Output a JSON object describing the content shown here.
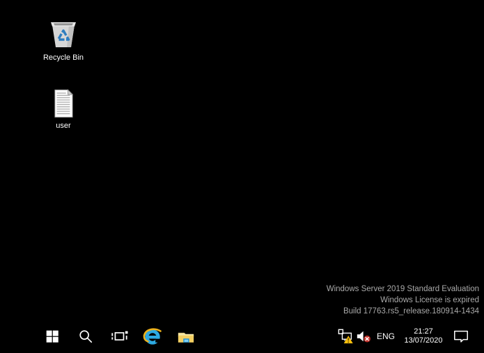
{
  "desktop": {
    "icons": [
      {
        "label": "Recycle Bin",
        "icon": "recycle-bin-icon"
      },
      {
        "label": "user",
        "icon": "text-file-icon"
      }
    ]
  },
  "watermark": {
    "line1": "Windows Server 2019 Standard Evaluation",
    "line2": "Windows License is expired",
    "line3": "Build 17763.rs5_release.180914-1434"
  },
  "taskbar": {
    "buttons": [
      {
        "name": "start",
        "icon": "windows-logo-icon"
      },
      {
        "name": "search",
        "icon": "search-icon"
      },
      {
        "name": "task-view",
        "icon": "task-view-icon"
      },
      {
        "name": "internet-explorer",
        "icon": "internet-explorer-icon"
      },
      {
        "name": "file-explorer",
        "icon": "file-explorer-icon"
      }
    ],
    "tray": {
      "network_icon": "ethernet-warning-icon",
      "volume_icon": "speaker-muted-icon",
      "language": "ENG",
      "time": "21:27",
      "date": "13/07/2020",
      "action_center_icon": "action-center-icon"
    }
  },
  "colors": {
    "background": "#000000",
    "watermark_gray": "#a9a9a9",
    "label_white": "#ffffff",
    "recycle_blue": "#2e7dbf",
    "ie_blue": "#2da9e1",
    "ie_gold": "#edb21d",
    "folder_back": "#f7ecae",
    "folder_front": "#f3cf63",
    "folder_accent_dark": "#1e90d6",
    "folder_accent_light": "#7fd0f5",
    "warning_yellow": "#ffc20e",
    "mute_red": "#c4332c"
  }
}
